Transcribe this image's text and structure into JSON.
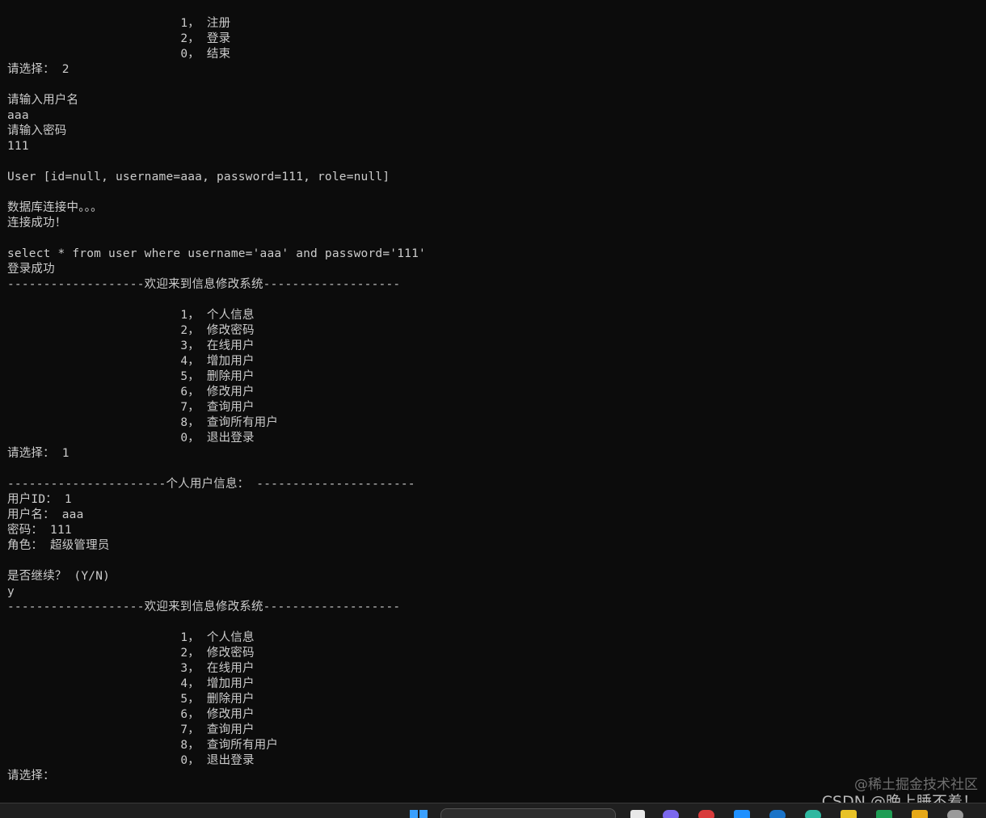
{
  "console": {
    "lines": [
      "                        1， 注册",
      "                        2， 登录",
      "                        0， 结束",
      "请选择： 2",
      "",
      "请输入用户名",
      "aaa",
      "请输入密码",
      "111",
      "",
      "User [id=null, username=aaa, password=111, role=null]",
      "",
      "数据库连接中。。。",
      "连接成功！",
      "",
      "select * from user where username='aaa' and password='111'",
      "登录成功",
      "-------------------欢迎来到信息修改系统-------------------",
      "",
      "                        1， 个人信息",
      "                        2， 修改密码",
      "                        3， 在线用户",
      "                        4， 增加用户",
      "                        5， 删除用户",
      "                        6， 修改用户",
      "                        7， 查询用户",
      "                        8， 查询所有用户",
      "                        0， 退出登录",
      "请选择： 1",
      "",
      "----------------------个人用户信息： ----------------------",
      "用户ID： 1",
      "用户名： aaa",
      "密码： 111",
      "角色： 超级管理员",
      "",
      "是否继续？ (Y/N)",
      "y",
      "-------------------欢迎来到信息修改系统-------------------",
      "",
      "                        1， 个人信息",
      "                        2， 修改密码",
      "                        3， 在线用户",
      "                        4， 增加用户",
      "                        5， 删除用户",
      "                        6， 修改用户",
      "                        7， 查询用户",
      "                        8， 查询所有用户",
      "                        0， 退出登录",
      "请选择："
    ]
  },
  "watermark": {
    "line1": "@稀土掘金技术社区",
    "line2": "CSDN @晚上睡不着！"
  },
  "colors": {
    "console_bg": "#0c0c0c",
    "console_text": "#cccccc",
    "taskbar_bg": "#1f1f1f"
  },
  "taskbar": {
    "icons": [
      "windows-start-icon",
      "search-box",
      "file-icon",
      "purple-app-icon",
      "red-app-icon",
      "blue-app-icon",
      "edge-icon",
      "chrome-icon",
      "yellow-app-icon",
      "green-app-icon",
      "folder-icon",
      "gear-icon"
    ]
  }
}
